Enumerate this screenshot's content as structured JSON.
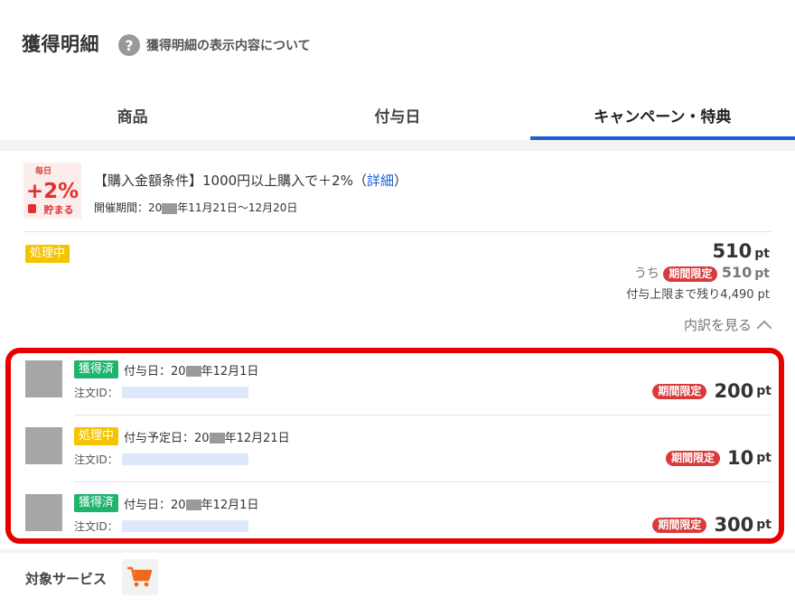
{
  "header": {
    "title": "獲得明細",
    "help_icon": "question-icon",
    "help_text": "獲得明細の表示内容について"
  },
  "tabs": [
    {
      "label": "商品",
      "active": false
    },
    {
      "label": "付与日",
      "active": false
    },
    {
      "label": "キャンペーン・特典",
      "active": true
    }
  ],
  "campaign": {
    "logo": {
      "top": "毎日",
      "mid": "+2%",
      "bottom": "貯まる"
    },
    "title_prefix": "【購入金額条件】1000円以上購入で＋2%（",
    "detail_link": "詳細",
    "title_suffix": "）",
    "period_prefix": "開催期間：20",
    "period_suffix": "年11月21日〜12月20日"
  },
  "summary": {
    "status": "処理中",
    "total": "510",
    "unit": "pt",
    "limited_prefix": "うち",
    "limited_badge": "期間限定",
    "limited_value": "510",
    "remaining": "付与上限まで残り4,490 pt",
    "breakdown_label": "内訳を見る"
  },
  "entries": [
    {
      "status": "獲得済",
      "status_type": "earned",
      "date_prefix": "付与日：20",
      "date_suffix": "年12月1日",
      "order_label": "注文ID：",
      "badge": "期間限定",
      "value": "200",
      "unit": "pt"
    },
    {
      "status": "処理中",
      "status_type": "processing",
      "date_prefix": "付与予定日：20",
      "date_suffix": "年12月21日",
      "order_label": "注文ID：",
      "badge": "期間限定",
      "value": "10",
      "unit": "pt"
    },
    {
      "status": "獲得済",
      "status_type": "earned",
      "date_prefix": "付与日：20",
      "date_suffix": "年12月1日",
      "order_label": "注文ID：",
      "badge": "期間限定",
      "value": "300",
      "unit": "pt"
    }
  ],
  "service": {
    "label": "対象サービス",
    "icon": "shopping-cart-icon"
  },
  "colors": {
    "accent": "#1a5fd3",
    "limited": "#d93a3a",
    "processing": "#f5c400",
    "earned": "#1fb46e",
    "highlight": "#e60000"
  }
}
